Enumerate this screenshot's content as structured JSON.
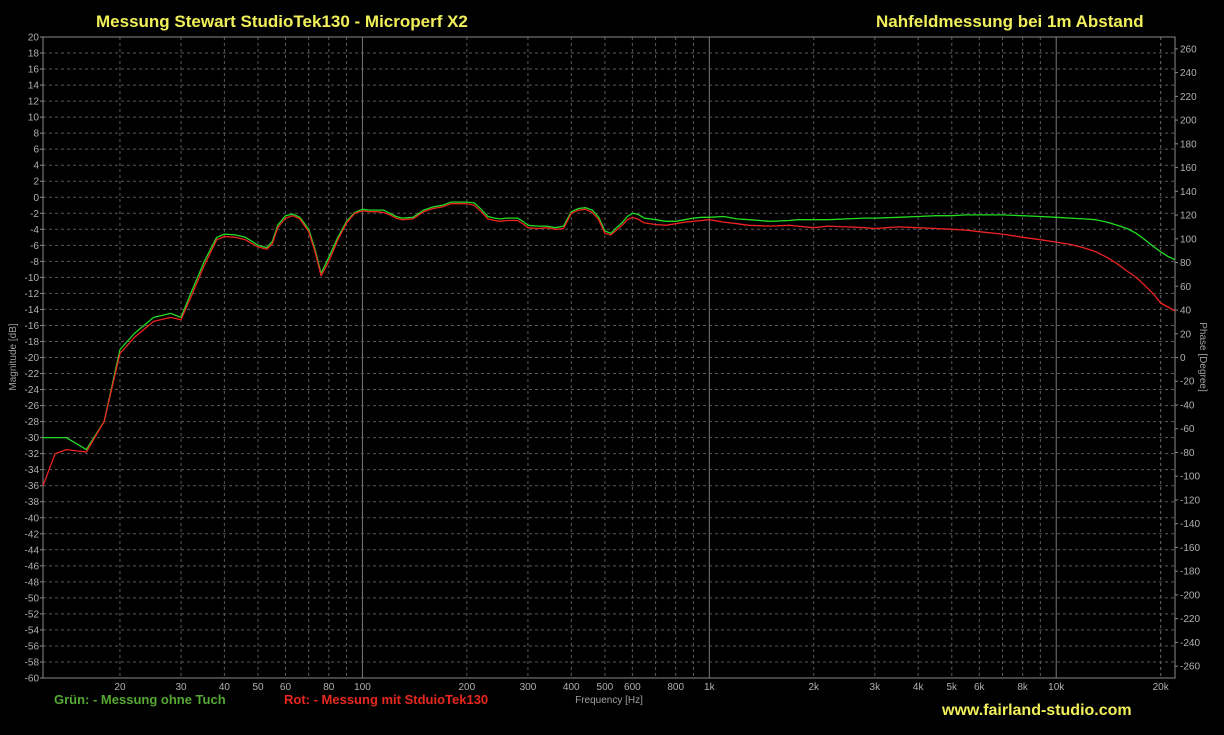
{
  "header": {
    "title_left": "Messung Stewart StudioTek130  - Microperf X2",
    "title_right": "Nahfeldmessung bei 1m Abstand"
  },
  "footer": {
    "legend_green": "Grün: - Messung ohne Tuch",
    "legend_red": "Rot: - Messung mit StduioTek130",
    "website": "www.fairland-studio.com"
  },
  "chart_data": {
    "type": "line",
    "xlabel": "Frequency [Hz]",
    "ylabel": "Magnitude [dB]",
    "y2label": "Phase [Degree]",
    "xscale": "log",
    "xlim": [
      12,
      22000
    ],
    "ylim": [
      -60,
      20
    ],
    "y2lim": [
      -270,
      270
    ],
    "grid": true,
    "x_ticks": [
      {
        "v": 20,
        "label": "20"
      },
      {
        "v": 30,
        "label": "30"
      },
      {
        "v": 40,
        "label": "40"
      },
      {
        "v": 50,
        "label": "50"
      },
      {
        "v": 60,
        "label": "60"
      },
      {
        "v": 80,
        "label": "80"
      },
      {
        "v": 100,
        "label": "100"
      },
      {
        "v": 300,
        "label": "300"
      },
      {
        "v": 400,
        "label": "400"
      },
      {
        "v": 500,
        "label": "500"
      },
      {
        "v": 600,
        "label": "600"
      },
      {
        "v": 800,
        "label": "800"
      },
      {
        "v": 1000,
        "label": "1k"
      },
      {
        "v": 2000,
        "label": "2k"
      },
      {
        "v": 3000,
        "label": "3k"
      },
      {
        "v": 4000,
        "label": "4k"
      },
      {
        "v": 5000,
        "label": "5k"
      },
      {
        "v": 6000,
        "label": "6k"
      },
      {
        "v": 8000,
        "label": "8k"
      },
      {
        "v": 10000,
        "label": "10k"
      },
      {
        "v": 20000,
        "label": "20k"
      }
    ],
    "extra_label": {
      "v": 200,
      "label": "200"
    },
    "y_ticks": [
      20,
      18,
      16,
      14,
      12,
      10,
      8,
      6,
      4,
      2,
      0,
      -2,
      -4,
      -6,
      -8,
      -10,
      -12,
      -14,
      -16,
      -18,
      -20,
      -22,
      -24,
      -26,
      -28,
      -30,
      -32,
      -34,
      -36,
      -38,
      -40,
      -42,
      -44,
      -46,
      -48,
      -50,
      -52,
      -54,
      -56,
      -58,
      -60
    ],
    "y2_ticks": [
      260,
      240,
      220,
      200,
      180,
      160,
      140,
      120,
      100,
      80,
      60,
      40,
      20,
      0,
      -20,
      -40,
      -60,
      -80,
      -100,
      -120,
      -140,
      -160,
      -180,
      -200,
      -220,
      -240,
      -260
    ],
    "series": [
      {
        "key": "green",
        "color": "#22dd22",
        "x": [
          12,
          14,
          16,
          18,
          20,
          22,
          25,
          28,
          30,
          32,
          35,
          38,
          40,
          43,
          46,
          48,
          50,
          53,
          55,
          57,
          60,
          63,
          66,
          70,
          73,
          76,
          80,
          85,
          90,
          95,
          100,
          105,
          110,
          115,
          120,
          125,
          130,
          140,
          150,
          160,
          170,
          180,
          190,
          200,
          210,
          220,
          230,
          240,
          250,
          260,
          270,
          280,
          290,
          300,
          320,
          340,
          360,
          380,
          400,
          420,
          440,
          460,
          480,
          500,
          520,
          540,
          560,
          580,
          600,
          620,
          650,
          700,
          750,
          800,
          850,
          900,
          950,
          1000,
          1100,
          1200,
          1300,
          1500,
          1700,
          1800,
          2000,
          2200,
          2500,
          2800,
          3000,
          3500,
          4000,
          4500,
          5000,
          5500,
          6000,
          7000,
          8000,
          9000,
          10000,
          11000,
          12000,
          13000,
          14000,
          15000,
          16000,
          17000,
          18000,
          19000,
          20000,
          21000,
          22000
        ],
        "y": [
          -30,
          -30,
          -31.5,
          -28,
          -19,
          -17,
          -15,
          -14.5,
          -15,
          -12,
          -8,
          -5,
          -4.6,
          -4.7,
          -5,
          -5.5,
          -6,
          -6.3,
          -5.5,
          -3.5,
          -2.3,
          -2.1,
          -2.5,
          -4,
          -6.5,
          -9.5,
          -7.5,
          -5,
          -3,
          -1.9,
          -1.5,
          -1.6,
          -1.6,
          -1.6,
          -2,
          -2.4,
          -2.6,
          -2.5,
          -1.6,
          -1.2,
          -1,
          -0.6,
          -0.6,
          -0.6,
          -0.7,
          -1.5,
          -2.4,
          -2.6,
          -2.7,
          -2.6,
          -2.6,
          -2.6,
          -3,
          -3.5,
          -3.6,
          -3.6,
          -3.8,
          -3.6,
          -1.8,
          -1.4,
          -1.3,
          -1.6,
          -2.5,
          -4.2,
          -4.5,
          -3.8,
          -3.2,
          -2.4,
          -2,
          -2.1,
          -2.6,
          -2.8,
          -3,
          -3,
          -2.8,
          -2.6,
          -2.5,
          -2.5,
          -2.4,
          -2.7,
          -2.8,
          -3,
          -2.9,
          -2.8,
          -2.8,
          -2.8,
          -2.7,
          -2.6,
          -2.6,
          -2.5,
          -2.4,
          -2.3,
          -2.3,
          -2.2,
          -2.2,
          -2.2,
          -2.3,
          -2.4,
          -2.5,
          -2.6,
          -2.7,
          -2.8,
          -3.1,
          -3.5,
          -3.9,
          -4.5,
          -5.3,
          -6.1,
          -6.8,
          -7.4,
          -7.8
        ],
        "y_note": "magnitude dB"
      },
      {
        "key": "red",
        "color": "#ee2222",
        "x": [
          12,
          13,
          14,
          16,
          18,
          20,
          22,
          25,
          28,
          30,
          32,
          35,
          38,
          40,
          43,
          46,
          48,
          50,
          53,
          55,
          57,
          60,
          63,
          66,
          70,
          73,
          76,
          80,
          85,
          90,
          95,
          100,
          105,
          110,
          115,
          120,
          125,
          130,
          140,
          150,
          160,
          170,
          180,
          190,
          200,
          210,
          220,
          230,
          240,
          250,
          260,
          270,
          280,
          290,
          300,
          320,
          340,
          360,
          380,
          400,
          420,
          440,
          460,
          480,
          500,
          520,
          540,
          560,
          580,
          600,
          620,
          650,
          700,
          750,
          800,
          850,
          900,
          950,
          1000,
          1100,
          1200,
          1300,
          1500,
          1700,
          1800,
          2000,
          2200,
          2500,
          2800,
          3000,
          3500,
          4000,
          4500,
          5000,
          5500,
          6000,
          7000,
          8000,
          9000,
          10000,
          11000,
          12000,
          13000,
          14000,
          15000,
          16000,
          17000,
          18000,
          19000,
          20000,
          21000,
          22000
        ],
        "y": [
          -36,
          -32,
          -31.5,
          -31.8,
          -28,
          -19.5,
          -17.5,
          -15.5,
          -15,
          -15.3,
          -12.5,
          -8.5,
          -5.3,
          -4.9,
          -5,
          -5.3,
          -5.8,
          -6.2,
          -6.5,
          -5.8,
          -3.8,
          -2.6,
          -2.3,
          -2.7,
          -4.3,
          -6.8,
          -9.8,
          -8,
          -5.3,
          -3.2,
          -2,
          -1.7,
          -1.8,
          -1.8,
          -1.9,
          -2.2,
          -2.6,
          -2.8,
          -2.7,
          -1.8,
          -1.4,
          -1.2,
          -0.8,
          -0.8,
          -0.8,
          -1,
          -1.8,
          -2.7,
          -2.9,
          -3,
          -2.9,
          -2.9,
          -2.9,
          -3.3,
          -3.8,
          -3.9,
          -3.8,
          -4,
          -3.9,
          -2,
          -1.6,
          -1.5,
          -1.9,
          -2.8,
          -4.5,
          -4.7,
          -4.1,
          -3.5,
          -2.8,
          -2.5,
          -2.7,
          -3.2,
          -3.4,
          -3.5,
          -3.3,
          -3.1,
          -3,
          -2.9,
          -2.8,
          -3.1,
          -3.3,
          -3.5,
          -3.6,
          -3.5,
          -3.6,
          -3.8,
          -3.6,
          -3.7,
          -3.8,
          -3.9,
          -3.7,
          -3.8,
          -3.9,
          -4,
          -4.1,
          -4.3,
          -4.6,
          -5,
          -5.3,
          -5.6,
          -5.9,
          -6.3,
          -6.8,
          -7.5,
          -8.3,
          -9.2,
          -10,
          -11,
          -12,
          -13.2,
          -13.7,
          -14.2
        ],
        "y_note": "magnitude dB"
      }
    ]
  }
}
